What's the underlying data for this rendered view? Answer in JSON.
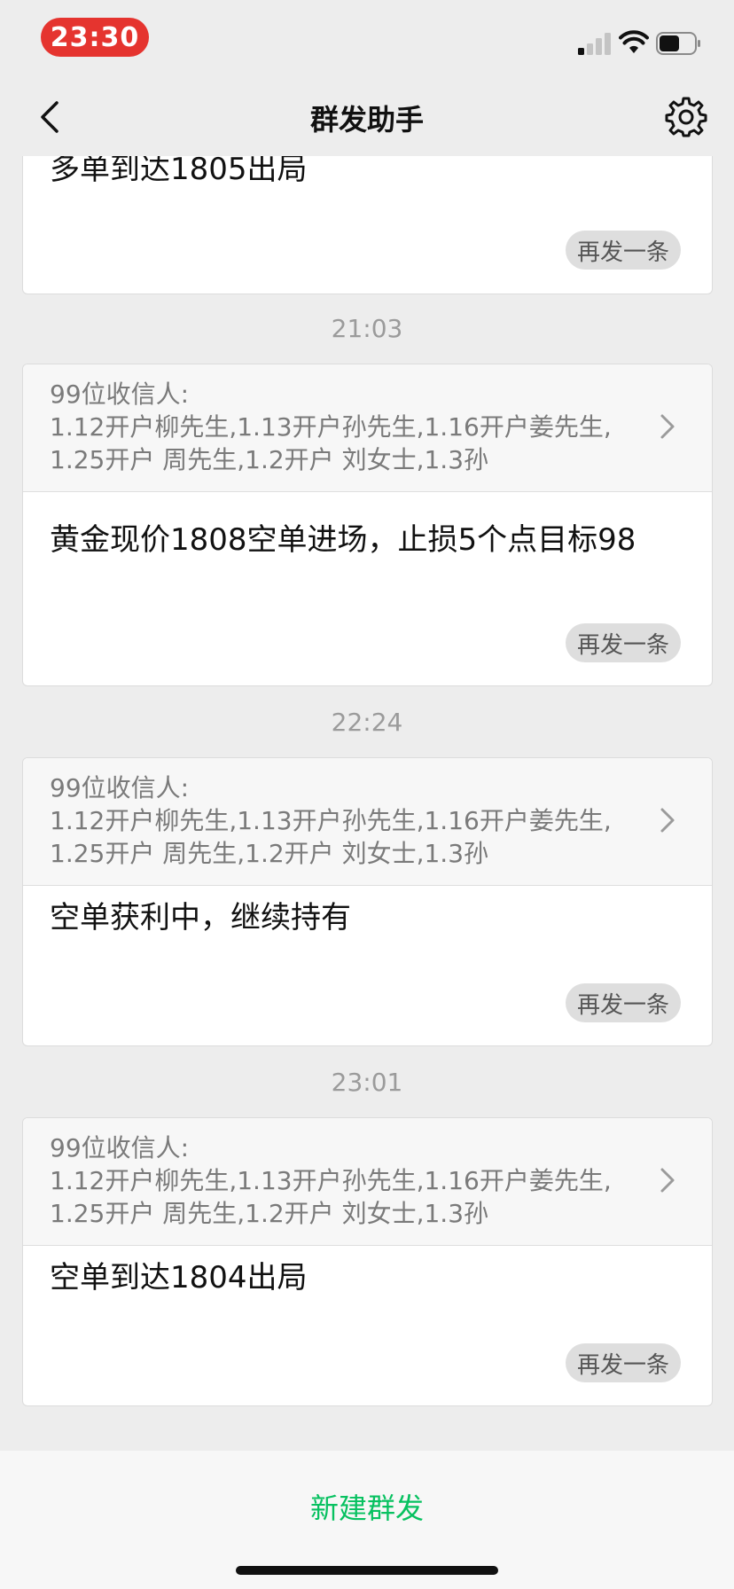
{
  "status_bar": {
    "time": "23:30"
  },
  "nav": {
    "title": "群发助手"
  },
  "cards": [
    {
      "message": "多单到达1805出局",
      "resend_label": "再发一条"
    },
    {
      "time": "21:03",
      "recipient_count": "99位收信人:",
      "recipients": "1.12开户柳先生,1.13开户孙先生,1.16开户姜先生,1.25开户 周先生,1.2开户 刘女士,1.3孙",
      "message": "黄金现价1808空单进场，止损5个点目标98",
      "resend_label": "再发一条"
    },
    {
      "time": "22:24",
      "recipient_count": "99位收信人:",
      "recipients": "1.12开户柳先生,1.13开户孙先生,1.16开户姜先生,1.25开户 周先生,1.2开户 刘女士,1.3孙",
      "message": "空单获利中，继续持有",
      "resend_label": "再发一条"
    },
    {
      "time": "23:01",
      "recipient_count": "99位收信人:",
      "recipients": "1.12开户柳先生,1.13开户孙先生,1.16开户姜先生,1.25开户 周先生,1.2开户 刘女士,1.3孙",
      "message": "空单到达1804出局",
      "resend_label": "再发一条"
    }
  ],
  "bottom": {
    "new_broadcast_label": "新建群发"
  },
  "colors": {
    "accent_green": "#07c160",
    "time_pill": "#e5342f",
    "background": "#ededed"
  }
}
